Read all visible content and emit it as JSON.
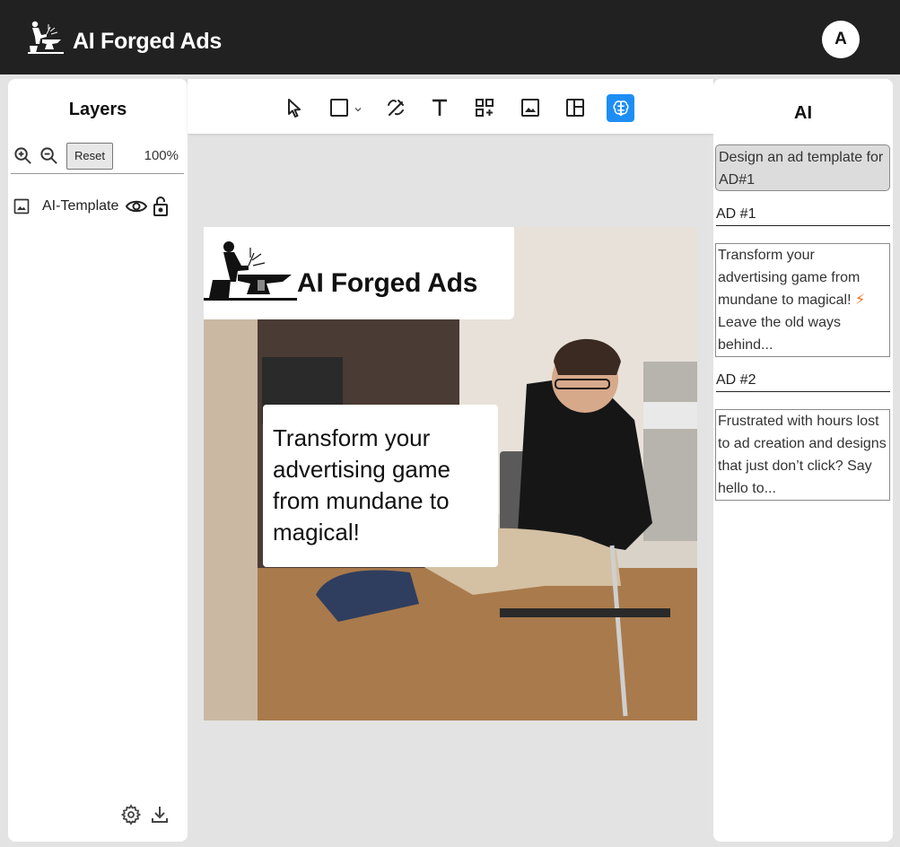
{
  "app": {
    "title": "AI Forged Ads",
    "user_initial": "A"
  },
  "layers_panel": {
    "title": "Layers",
    "reset_label": "Reset",
    "zoom_level": "100%",
    "layers": [
      {
        "label": "AI-Template",
        "visible": true,
        "locked": false
      }
    ]
  },
  "toolbar": {
    "tools": [
      "select-icon",
      "rectangle-icon",
      "chevron-down-icon",
      "magic-pen-icon",
      "text-icon",
      "qr-code-icon",
      "image-icon",
      "layout-icon",
      "ai-brain-icon"
    ],
    "active_tool": "ai-brain-icon",
    "accent_color": "#1e8ef5"
  },
  "canvas": {
    "logo_text": "AI Forged Ads",
    "ad_text": "Transform your advertising game from mundane to magical!"
  },
  "ai_panel": {
    "title": "AI",
    "prompt": "Design an ad template for AD#1",
    "ads": [
      {
        "heading": "AD #1",
        "body_before": "Transform your advertising game from mundane to magical!",
        "emoji": "⚡",
        "body_after": "Leave the old ways behind..."
      },
      {
        "heading": "AD #2",
        "body": "Frustrated with hours lost to ad creation and designs that just don’t click? Say hello to..."
      }
    ]
  }
}
